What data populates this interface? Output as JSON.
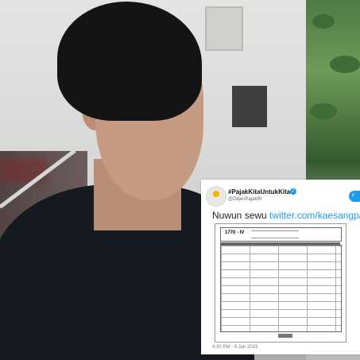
{
  "tweet": {
    "display_name": "#PajakKitaUntukKita",
    "username": "@DitjenPajakRI",
    "message": "Nuwun sewu ",
    "link_text": "twitter.com/kaesangp/s",
    "follow_label": "F",
    "timestamp": "4:30 PM - 9 Jun 2019",
    "doc_code": "1770 - IV"
  },
  "icons": {
    "verified": "verified-badge-icon",
    "avatar": "djp-logo-icon"
  },
  "colors": {
    "twitter_blue": "#1d9bf0",
    "shirt": "#151a20",
    "hair": "#141414"
  }
}
